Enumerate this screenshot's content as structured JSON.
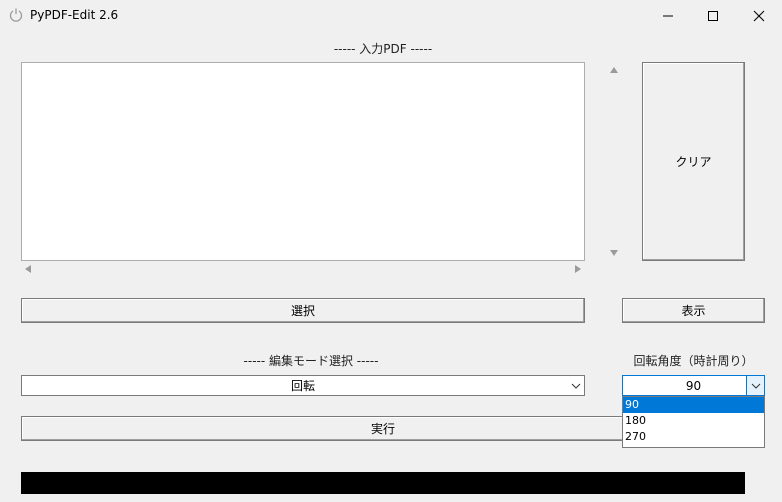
{
  "window": {
    "title": "PyPDF-Edit 2.6"
  },
  "input_section": {
    "label": "----- 入力PDF -----",
    "clear_label": "クリア",
    "select_label": "選択",
    "show_label": "表示"
  },
  "mode_section": {
    "label": "----- 編集モード選択 -----",
    "selected": "回転"
  },
  "rotation_section": {
    "label": "回転角度（時計周り）",
    "selected": "90",
    "options": [
      "90",
      "180",
      "270"
    ]
  },
  "run_label": "実行",
  "colors": {
    "window_bg": "#f0f0f0",
    "selection": "#0078d7",
    "progress": "#000000"
  }
}
